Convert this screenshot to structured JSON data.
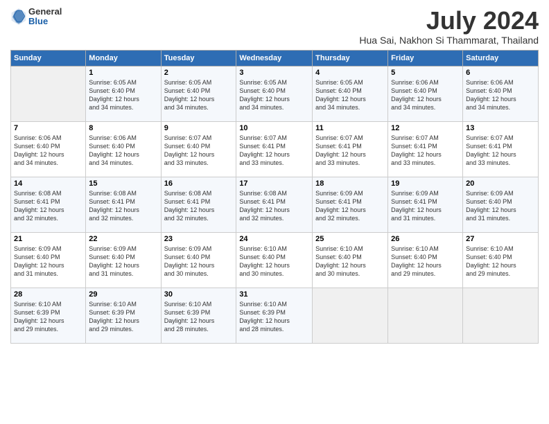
{
  "header": {
    "logo": {
      "line1": "General",
      "line2": "Blue"
    },
    "title": "July 2024",
    "location": "Hua Sai, Nakhon Si Thammarat, Thailand"
  },
  "calendar": {
    "days_of_week": [
      "Sunday",
      "Monday",
      "Tuesday",
      "Wednesday",
      "Thursday",
      "Friday",
      "Saturday"
    ],
    "weeks": [
      [
        {
          "day": "",
          "info": ""
        },
        {
          "day": "1",
          "info": "Sunrise: 6:05 AM\nSunset: 6:40 PM\nDaylight: 12 hours\nand 34 minutes."
        },
        {
          "day": "2",
          "info": "Sunrise: 6:05 AM\nSunset: 6:40 PM\nDaylight: 12 hours\nand 34 minutes."
        },
        {
          "day": "3",
          "info": "Sunrise: 6:05 AM\nSunset: 6:40 PM\nDaylight: 12 hours\nand 34 minutes."
        },
        {
          "day": "4",
          "info": "Sunrise: 6:05 AM\nSunset: 6:40 PM\nDaylight: 12 hours\nand 34 minutes."
        },
        {
          "day": "5",
          "info": "Sunrise: 6:06 AM\nSunset: 6:40 PM\nDaylight: 12 hours\nand 34 minutes."
        },
        {
          "day": "6",
          "info": "Sunrise: 6:06 AM\nSunset: 6:40 PM\nDaylight: 12 hours\nand 34 minutes."
        }
      ],
      [
        {
          "day": "7",
          "info": "Sunrise: 6:06 AM\nSunset: 6:40 PM\nDaylight: 12 hours\nand 34 minutes."
        },
        {
          "day": "8",
          "info": "Sunrise: 6:06 AM\nSunset: 6:40 PM\nDaylight: 12 hours\nand 34 minutes."
        },
        {
          "day": "9",
          "info": "Sunrise: 6:07 AM\nSunset: 6:40 PM\nDaylight: 12 hours\nand 33 minutes."
        },
        {
          "day": "10",
          "info": "Sunrise: 6:07 AM\nSunset: 6:41 PM\nDaylight: 12 hours\nand 33 minutes."
        },
        {
          "day": "11",
          "info": "Sunrise: 6:07 AM\nSunset: 6:41 PM\nDaylight: 12 hours\nand 33 minutes."
        },
        {
          "day": "12",
          "info": "Sunrise: 6:07 AM\nSunset: 6:41 PM\nDaylight: 12 hours\nand 33 minutes."
        },
        {
          "day": "13",
          "info": "Sunrise: 6:07 AM\nSunset: 6:41 PM\nDaylight: 12 hours\nand 33 minutes."
        }
      ],
      [
        {
          "day": "14",
          "info": "Sunrise: 6:08 AM\nSunset: 6:41 PM\nDaylight: 12 hours\nand 32 minutes."
        },
        {
          "day": "15",
          "info": "Sunrise: 6:08 AM\nSunset: 6:41 PM\nDaylight: 12 hours\nand 32 minutes."
        },
        {
          "day": "16",
          "info": "Sunrise: 6:08 AM\nSunset: 6:41 PM\nDaylight: 12 hours\nand 32 minutes."
        },
        {
          "day": "17",
          "info": "Sunrise: 6:08 AM\nSunset: 6:41 PM\nDaylight: 12 hours\nand 32 minutes."
        },
        {
          "day": "18",
          "info": "Sunrise: 6:09 AM\nSunset: 6:41 PM\nDaylight: 12 hours\nand 32 minutes."
        },
        {
          "day": "19",
          "info": "Sunrise: 6:09 AM\nSunset: 6:41 PM\nDaylight: 12 hours\nand 31 minutes."
        },
        {
          "day": "20",
          "info": "Sunrise: 6:09 AM\nSunset: 6:40 PM\nDaylight: 12 hours\nand 31 minutes."
        }
      ],
      [
        {
          "day": "21",
          "info": "Sunrise: 6:09 AM\nSunset: 6:40 PM\nDaylight: 12 hours\nand 31 minutes."
        },
        {
          "day": "22",
          "info": "Sunrise: 6:09 AM\nSunset: 6:40 PM\nDaylight: 12 hours\nand 31 minutes."
        },
        {
          "day": "23",
          "info": "Sunrise: 6:09 AM\nSunset: 6:40 PM\nDaylight: 12 hours\nand 30 minutes."
        },
        {
          "day": "24",
          "info": "Sunrise: 6:10 AM\nSunset: 6:40 PM\nDaylight: 12 hours\nand 30 minutes."
        },
        {
          "day": "25",
          "info": "Sunrise: 6:10 AM\nSunset: 6:40 PM\nDaylight: 12 hours\nand 30 minutes."
        },
        {
          "day": "26",
          "info": "Sunrise: 6:10 AM\nSunset: 6:40 PM\nDaylight: 12 hours\nand 29 minutes."
        },
        {
          "day": "27",
          "info": "Sunrise: 6:10 AM\nSunset: 6:40 PM\nDaylight: 12 hours\nand 29 minutes."
        }
      ],
      [
        {
          "day": "28",
          "info": "Sunrise: 6:10 AM\nSunset: 6:39 PM\nDaylight: 12 hours\nand 29 minutes."
        },
        {
          "day": "29",
          "info": "Sunrise: 6:10 AM\nSunset: 6:39 PM\nDaylight: 12 hours\nand 29 minutes."
        },
        {
          "day": "30",
          "info": "Sunrise: 6:10 AM\nSunset: 6:39 PM\nDaylight: 12 hours\nand 28 minutes."
        },
        {
          "day": "31",
          "info": "Sunrise: 6:10 AM\nSunset: 6:39 PM\nDaylight: 12 hours\nand 28 minutes."
        },
        {
          "day": "",
          "info": ""
        },
        {
          "day": "",
          "info": ""
        },
        {
          "day": "",
          "info": ""
        }
      ]
    ]
  }
}
